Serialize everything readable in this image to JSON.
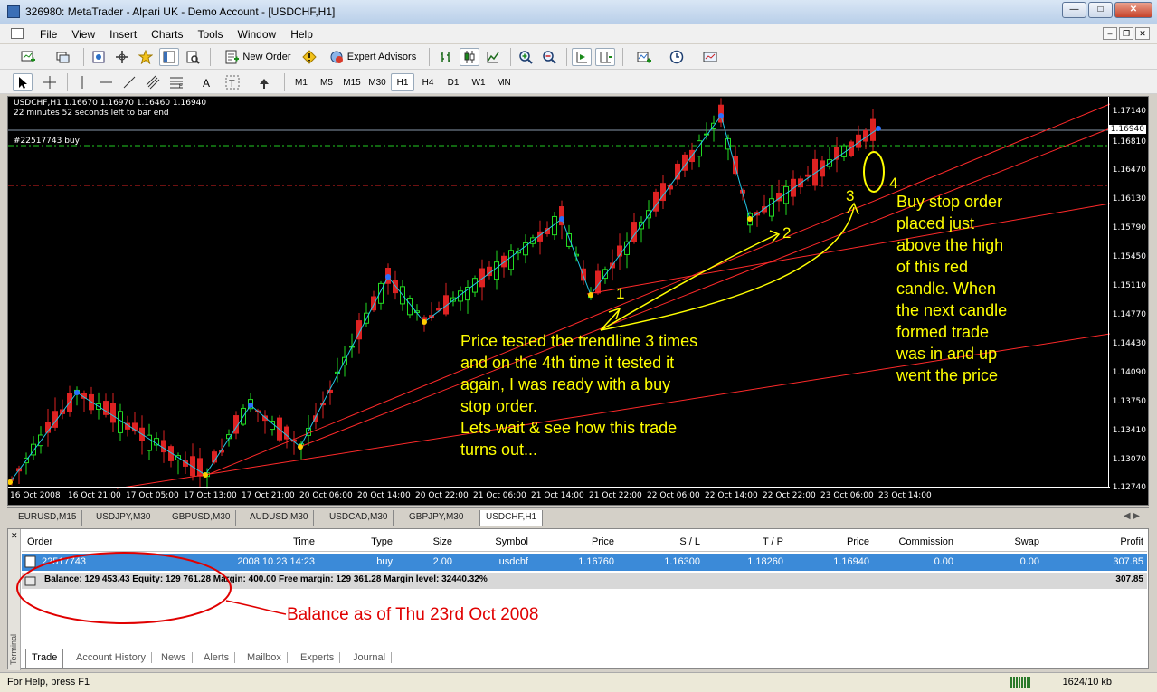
{
  "window": {
    "title": "326980: MetaTrader - Alpari UK - Demo Account - [USDCHF,H1]",
    "minimize": "0",
    "maximize": "1",
    "close": "r"
  },
  "menu": [
    "File",
    "View",
    "Insert",
    "Charts",
    "Tools",
    "Window",
    "Help"
  ],
  "toolbar": {
    "new_order": "New Order",
    "expert_advisors": "Expert Advisors",
    "timeframes": [
      "M1",
      "M5",
      "M15",
      "M30",
      "H1",
      "H4",
      "D1",
      "W1",
      "MN"
    ],
    "active_timeframe": "H1"
  },
  "chart": {
    "header_line1": "USDCHF,H1  1.16670 1.16970 1.16460 1.16940",
    "header_line2": "22 minutes 52 seconds left to bar end",
    "order_label": "#22517743 buy",
    "price_labels": [
      "1.17140",
      "1.16940",
      "1.16810",
      "1.16470",
      "1.16130",
      "1.15790",
      "1.15450",
      "1.15110",
      "1.14770",
      "1.14430",
      "1.14090",
      "1.13750",
      "1.13410",
      "1.13070",
      "1.12740"
    ],
    "current_price": "1.16940",
    "time_labels": [
      "16 Oct 2008",
      "16 Oct 21:00",
      "17 Oct 05:00",
      "17 Oct 13:00",
      "17 Oct 21:00",
      "20 Oct 06:00",
      "20 Oct 14:00",
      "20 Oct 22:00",
      "21 Oct 06:00",
      "21 Oct 14:00",
      "21 Oct 22:00",
      "22 Oct 06:00",
      "22 Oct 14:00",
      "22 Oct 22:00",
      "23 Oct 06:00",
      "23 Oct 14:00"
    ],
    "annotation_left": [
      "Price tested the trendline 3 times",
      "and on the 4th time it tested it",
      "again, I was ready with a buy",
      "stop order.",
      "Lets wait & see how this trade",
      "turns out..."
    ],
    "annotation_right": [
      "Buy stop order",
      "placed just",
      "above the high",
      "of this red",
      "candle. When",
      "the next candle",
      "formed trade",
      "was in and up",
      "went the price"
    ],
    "numbers": [
      "1",
      "2",
      "3",
      "4"
    ]
  },
  "chart_tabs": [
    "EURUSD,M15",
    "USDJPY,M30",
    "GBPUSD,M30",
    "AUDUSD,M30",
    "USDCAD,M30",
    "GBPJPY,M30",
    "USDCHF,H1"
  ],
  "active_chart_tab": "USDCHF,H1",
  "terminal": {
    "columns": [
      "Order",
      "Time",
      "Type",
      "Size",
      "Symbol",
      "Price",
      "S / L",
      "T / P",
      "Price",
      "Commission",
      "Swap",
      "Profit"
    ],
    "row": {
      "order": "22517743",
      "time": "2008.10.23 14:23",
      "type": "buy",
      "size": "2.00",
      "symbol": "usdchf",
      "price": "1.16760",
      "sl": "1.16300",
      "tp": "1.18260",
      "cur_price": "1.16940",
      "commission": "0.00",
      "swap": "0.00",
      "profit": "307.85"
    },
    "balance_line": "Balance: 129 453.43  Equity: 129 761.28  Margin: 400.00  Free margin: 129 361.28  Margin level: 32440.32%",
    "balance_profit": "307.85",
    "tabs": [
      "Trade",
      "Account History",
      "News",
      "Alerts",
      "Mailbox",
      "Experts",
      "Journal"
    ],
    "side_label": "Terminal"
  },
  "note": "Balance as of Thu 23rd Oct 2008",
  "status": {
    "help": "For Help, press F1",
    "traffic": "1624/10 kb"
  }
}
